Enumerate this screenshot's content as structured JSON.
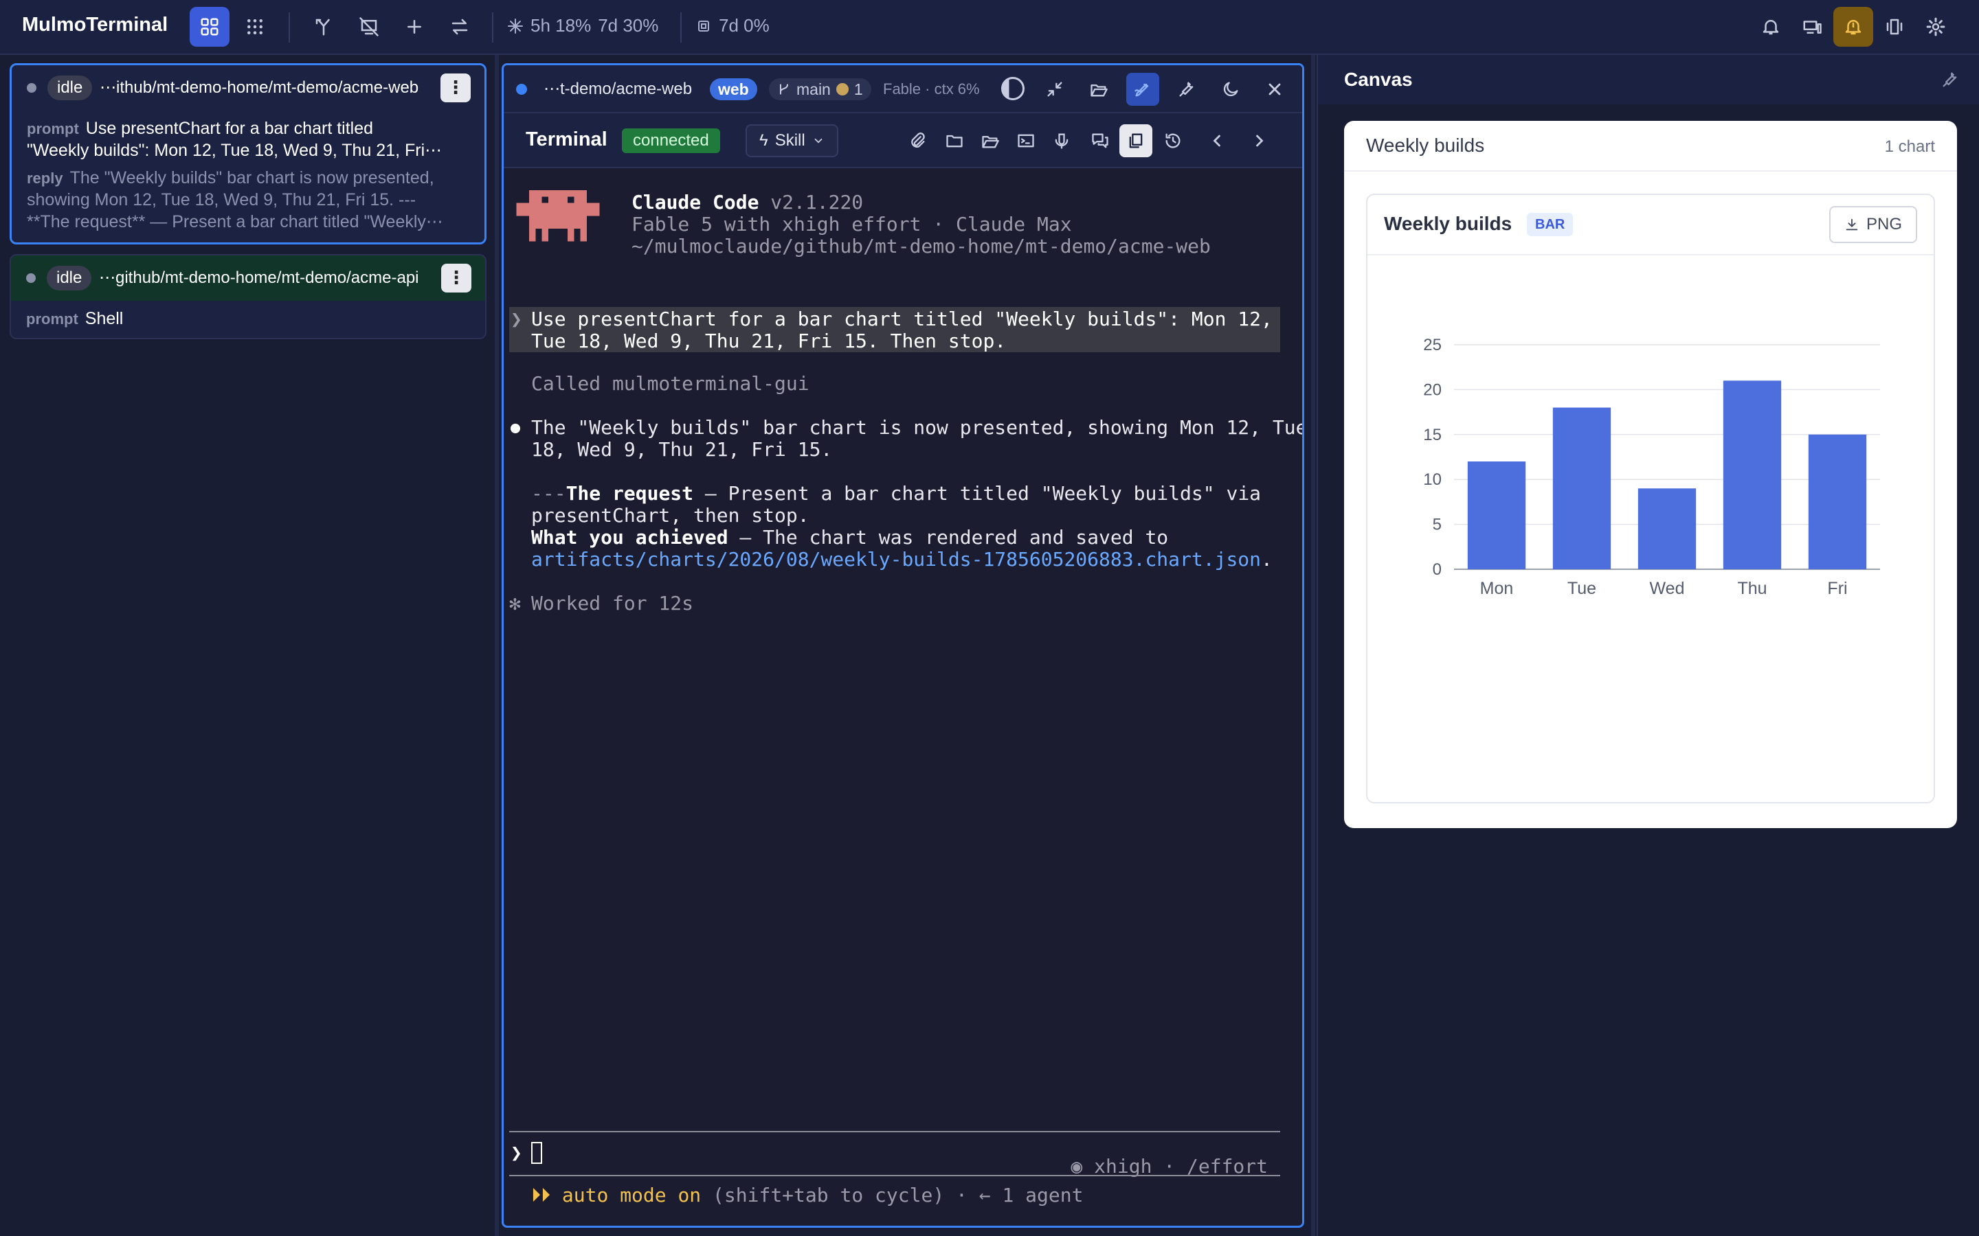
{
  "app": {
    "title": "MulmoTerminal",
    "usage_5h": "5h 18%",
    "usage_7d": "7d 30%",
    "usage_7d_other": "7d 0%"
  },
  "sessions": [
    {
      "status": "idle",
      "path": "⋯ithub/mt-demo-home/mt-demo/acme-web",
      "prompt_label": "prompt",
      "prompt_line1": "Use presentChart for a bar chart titled",
      "prompt_line2": "\"Weekly builds\": Mon 12, Tue 18, Wed 9, Thu 21, Fri⋯",
      "reply_label": "reply",
      "reply_line1": "The \"Weekly builds\" bar chart is now presented,",
      "reply_line2": "showing Mon 12, Tue 18, Wed 9, Thu 21, Fri 15. ---",
      "reply_line3": "**The request** — Present a bar chart titled \"Weekly⋯"
    },
    {
      "status": "idle",
      "path": "⋯github/mt-demo-home/mt-demo/acme-api",
      "prompt_label": "prompt",
      "prompt_line1": "Shell"
    }
  ],
  "terminal": {
    "tab_path": "⋯t-demo/acme-web",
    "tab_badge": "web",
    "branch": "main",
    "branch_count": "1",
    "model_ctx": "Fable · ctx 6%",
    "title": "Terminal",
    "status": "connected",
    "skill_label": "Skill",
    "header_name": "Claude Code",
    "header_version": "v2.1.220",
    "header_line2": "Fable 5 with xhigh effort · Claude Max",
    "header_line3": "~/mulmoclaude/github/mt-demo-home/mt-demo/acme-web",
    "user_msg_line1": "Use presentChart for a bar chart titled \"Weekly builds\": Mon 12,",
    "user_msg_line2": "Tue 18, Wed 9, Thu 21, Fri 15. Then stop.",
    "called": "Called mulmoterminal-gui",
    "reply_line1": "The \"Weekly builds\" bar chart is now presented, showing Mon 12, Tue",
    "reply_line2": "18, Wed 9, Thu 21, Fri 15.",
    "request_prefix": "---",
    "request_bold": "The request",
    "request_rest": " — Present a bar chart titled \"Weekly builds\" via",
    "request_line2": "presentChart, then stop.",
    "achieved_bold": "What you achieved",
    "achieved_rest": " — The chart was rendered and saved to",
    "artifact_path": "artifacts/charts/2026/08/weekly-builds-1785605206883.chart.json",
    "artifact_dot": ".",
    "worked": "Worked for 12s",
    "effort_hint": "◉ xhigh · /effort",
    "prompt_symbol": "❯",
    "auto_mode_arrows": "⏵⏵",
    "auto_mode_on": "auto mode on",
    "auto_mode_rest": " (shift+tab to cycle) · ← 1 agent"
  },
  "canvas": {
    "title": "Canvas",
    "card_title": "Weekly builds",
    "chart_count": "1 chart",
    "chart_title": "Weekly builds",
    "chart_badge": "BAR",
    "png_label": "PNG"
  },
  "colors": {
    "accent": "#3b5bdb",
    "bar": "#4c6fdd",
    "connected_bg": "#1f7a3b",
    "bell_active_bg": "#7a5a10"
  },
  "chart_data": {
    "type": "bar",
    "categories": [
      "Mon",
      "Tue",
      "Wed",
      "Thu",
      "Fri"
    ],
    "values": [
      12,
      18,
      9,
      21,
      15
    ],
    "yticks": [
      0,
      5,
      10,
      15,
      20,
      25
    ],
    "ylim": [
      0,
      25
    ],
    "grid": true
  }
}
